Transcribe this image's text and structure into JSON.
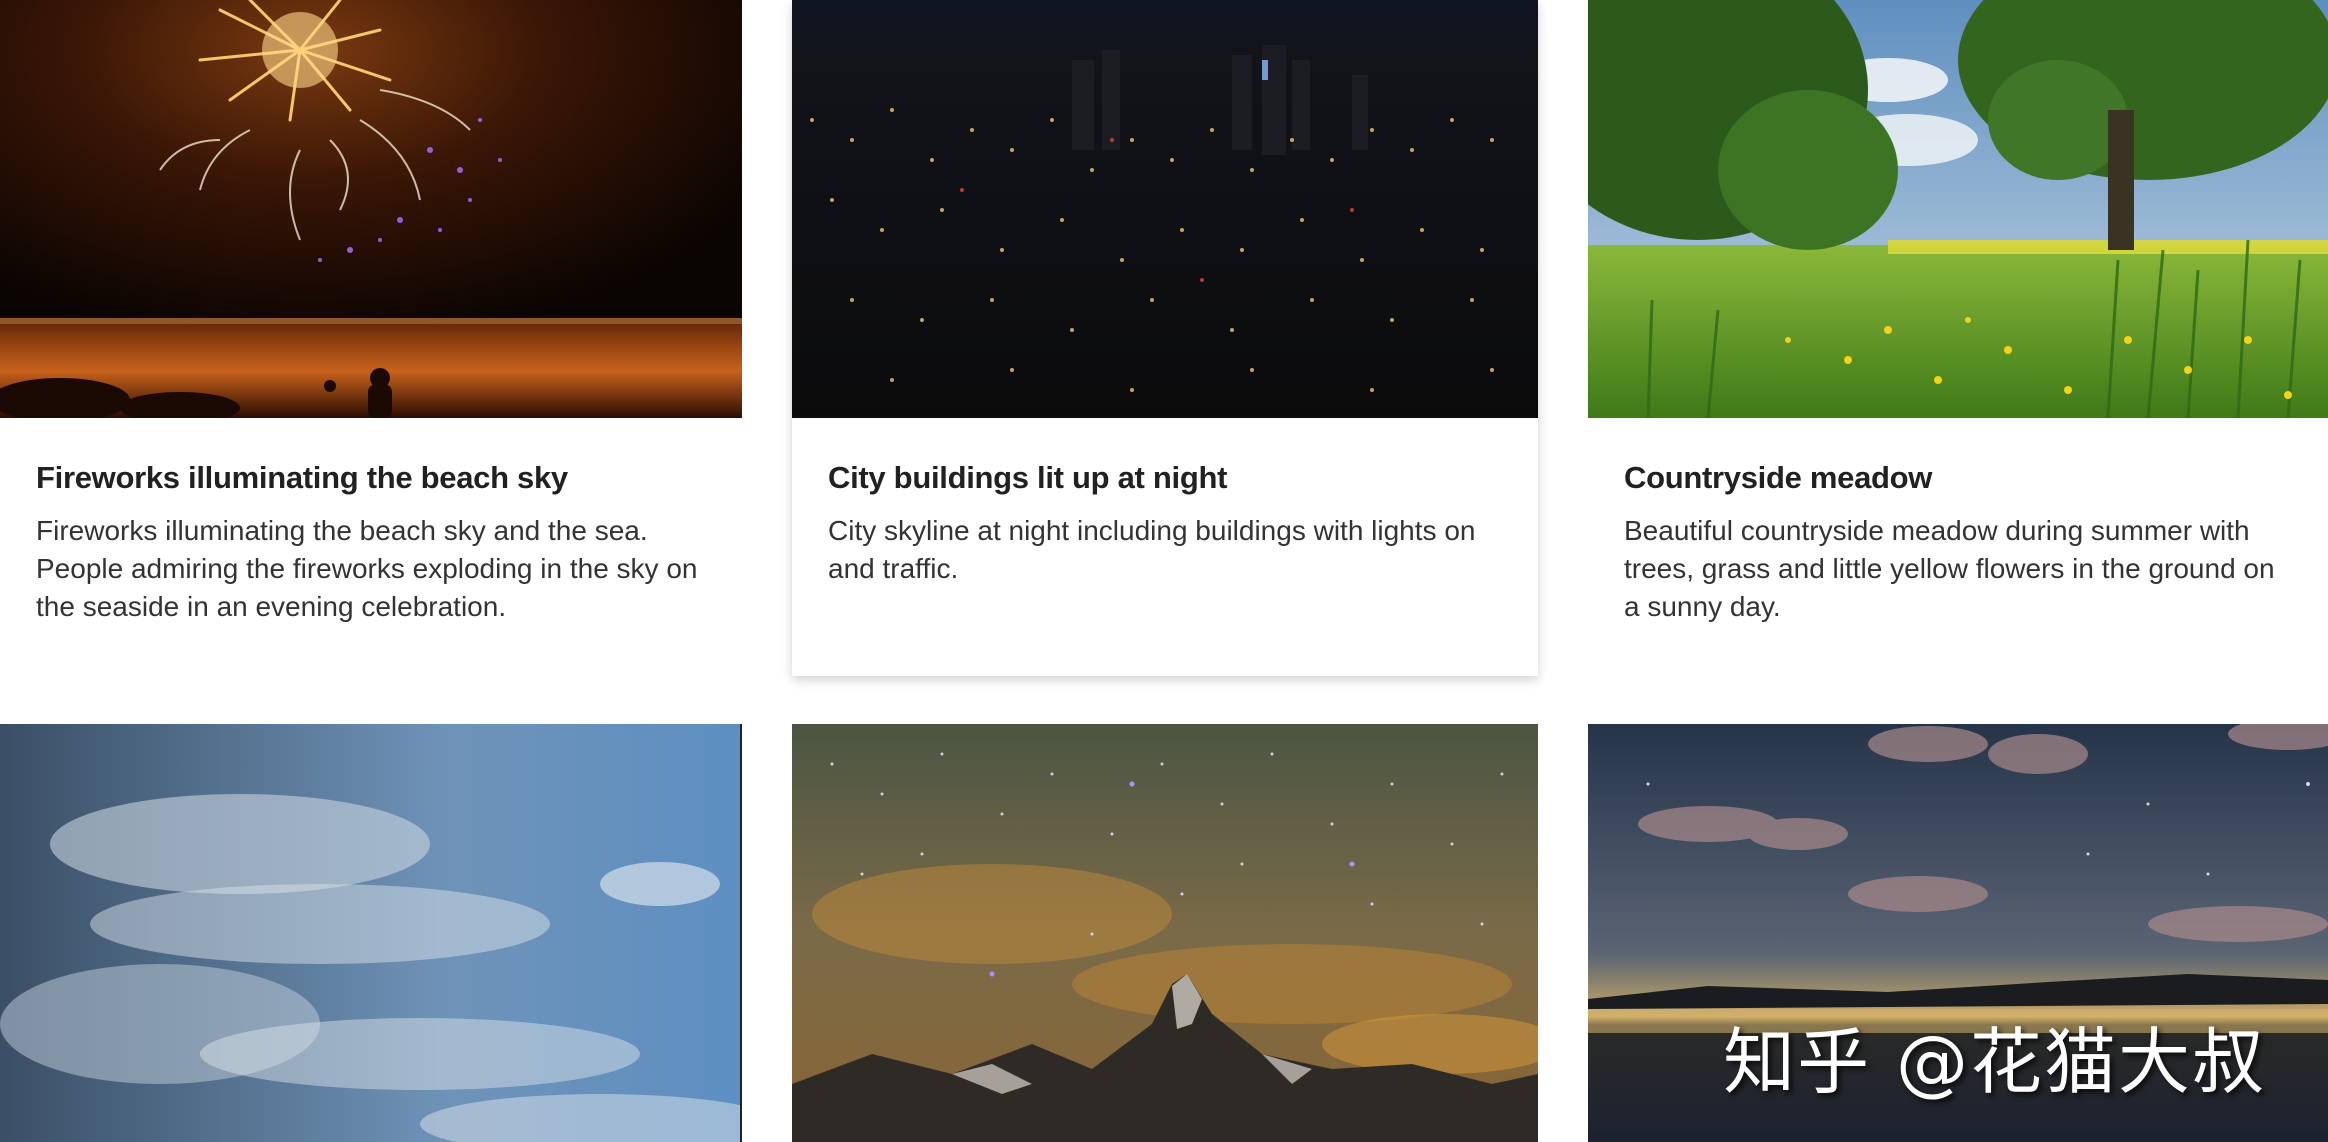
{
  "cards": [
    {
      "title": "Fireworks illuminating the beach sky",
      "description": "Fireworks illuminating the beach sky and the sea. People admiring the fireworks exploding in the sky on the seaside in an evening celebration.",
      "image": "fireworks-beach-image"
    },
    {
      "title": "City buildings lit up at night",
      "description": "City skyline at night including buildings with lights on and traffic.",
      "image": "city-night-image"
    },
    {
      "title": "Countryside meadow",
      "description": "Beautiful countryside meadow during summer with trees, grass and little yellow flowers in the ground on a sunny day.",
      "image": "meadow-image"
    },
    {
      "title": "",
      "description": "",
      "image": "cloudy-sky-image"
    },
    {
      "title": "",
      "description": "",
      "image": "starry-mountain-image"
    },
    {
      "title": "",
      "description": "",
      "image": "lake-night-sky-image"
    }
  ],
  "watermark": "知乎 @花猫大叔"
}
